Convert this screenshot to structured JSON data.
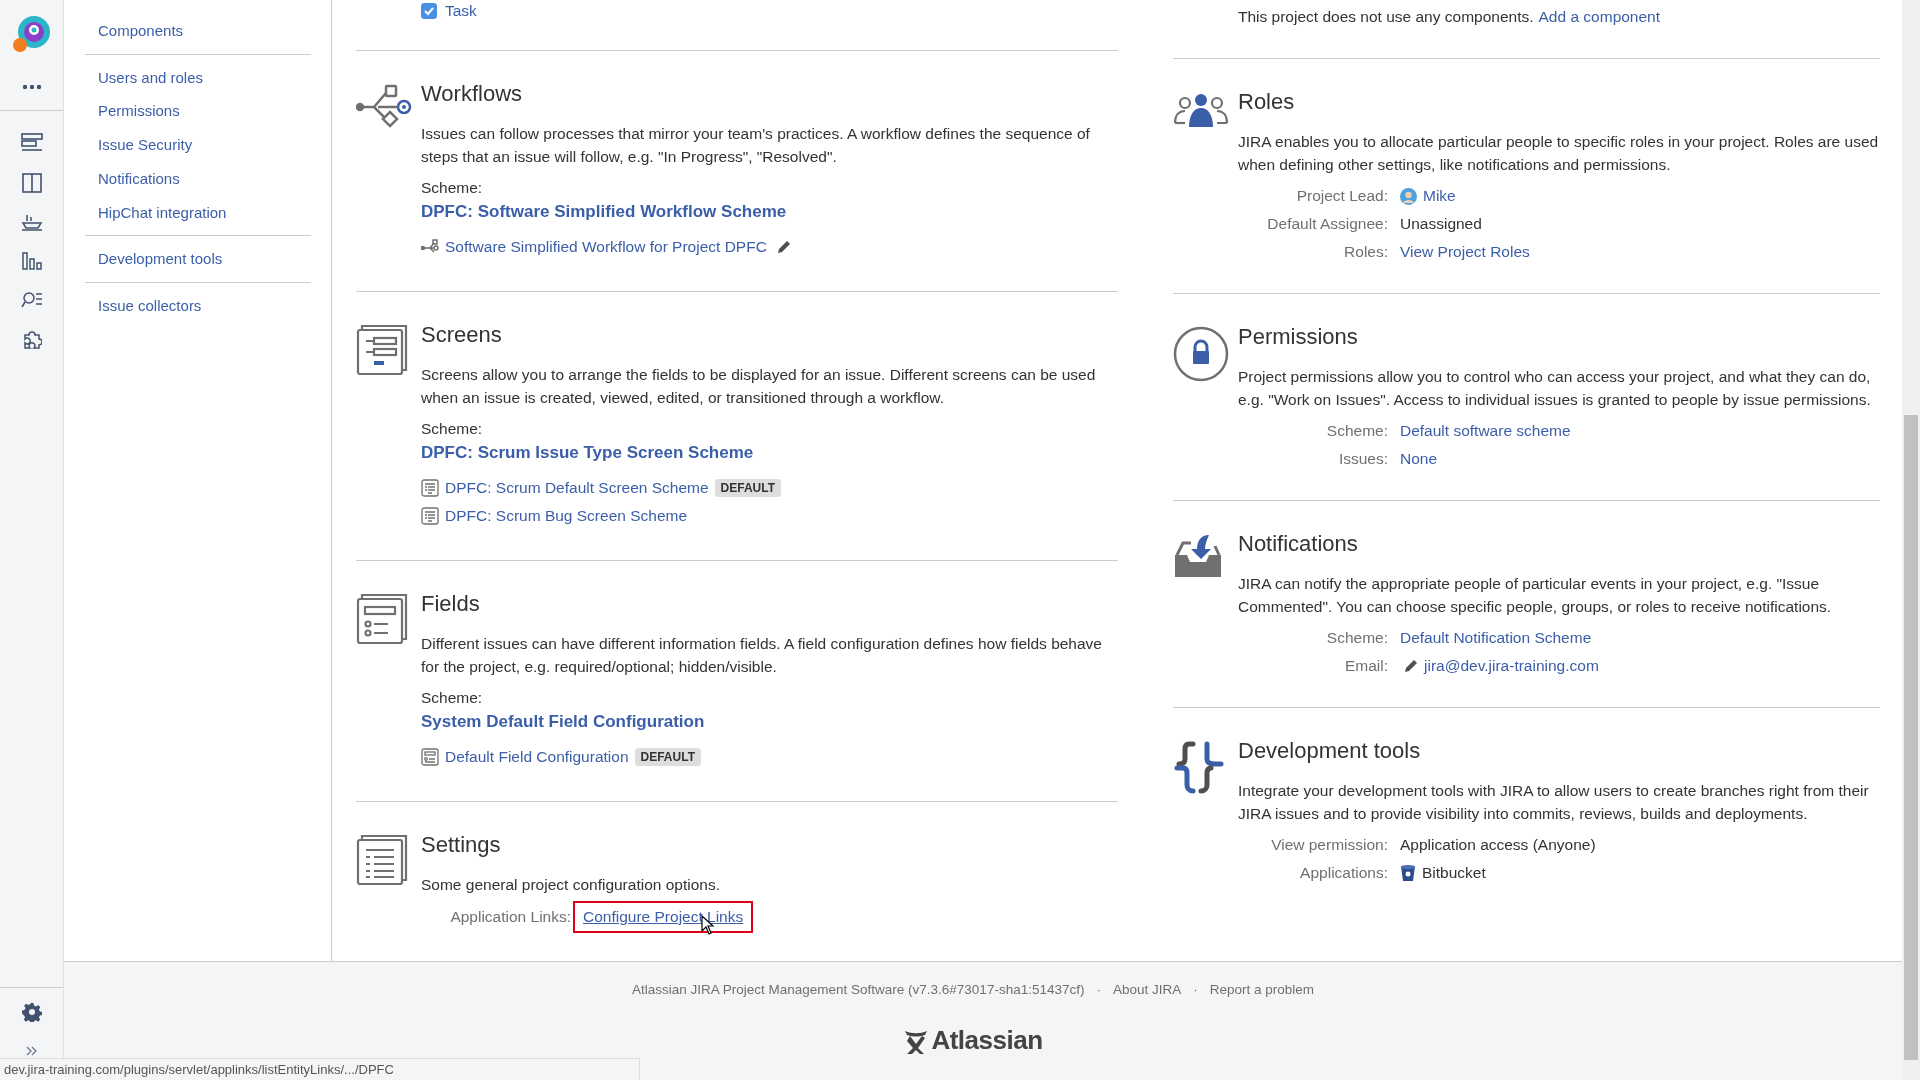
{
  "sidebar": {
    "groups": [
      [
        {
          "label": "Components"
        }
      ],
      [
        {
          "label": "Users and roles"
        },
        {
          "label": "Permissions"
        },
        {
          "label": "Issue Security"
        },
        {
          "label": "Notifications"
        },
        {
          "label": "HipChat integration"
        }
      ],
      [
        {
          "label": "Development tools"
        }
      ],
      [
        {
          "label": "Issue collectors"
        }
      ]
    ]
  },
  "left_column": {
    "top": {
      "label": "Task",
      "checked": true
    },
    "sections": [
      {
        "kind": "workflows",
        "title": "Workflows",
        "description": "Issues can follow processes that mirror your team's practices. A workflow defines the sequence of steps that an issue will follow, e.g. \"In Progress\", \"Resolved\".",
        "scheme_label": "Scheme:",
        "scheme": "DPFC: Software Simplified Workflow Scheme",
        "items": [
          {
            "label": "Software Simplified Workflow for Project DPFC",
            "editable": true
          }
        ]
      },
      {
        "kind": "screens",
        "title": "Screens",
        "description": "Screens allow you to arrange the fields to be displayed for an issue. Different screens can be used when an issue is created, viewed, edited, or transitioned through a workflow.",
        "scheme_label": "Scheme:",
        "scheme": "DPFC: Scrum Issue Type Screen Scheme",
        "items": [
          {
            "label": "DPFC: Scrum Default Screen Scheme",
            "badge": "DEFAULT",
            "editable": false
          },
          {
            "label": "DPFC: Scrum Bug Screen Scheme",
            "editable": false
          }
        ]
      },
      {
        "kind": "fields",
        "title": "Fields",
        "description": "Different issues can have different information fields. A field configuration defines how fields behave for the project, e.g. required/optional; hidden/visible.",
        "scheme_label": "Scheme:",
        "scheme": "System Default Field Configuration",
        "items": [
          {
            "label": "Default Field Configuration",
            "badge": "DEFAULT",
            "editable": false
          }
        ]
      },
      {
        "kind": "settings",
        "title": "Settings",
        "description": "Some general project configuration options.",
        "properties": [
          {
            "label": "Application Links:",
            "value": "Configure Project Links",
            "kind": "link",
            "highlighted": true
          }
        ]
      }
    ]
  },
  "right_column": {
    "top": {
      "text": "This project does not use any components.",
      "link": "Add a component"
    },
    "sections": [
      {
        "kind": "roles",
        "title": "Roles",
        "description": "JIRA enables you to allocate particular people to specific roles in your project. Roles are used when defining other settings, like notifications and permissions.",
        "properties": [
          {
            "label": "Project Lead:",
            "value": "Mike",
            "kind": "person"
          },
          {
            "label": "Default Assignee:",
            "value": "Unassigned",
            "kind": "text"
          },
          {
            "label": "Roles:",
            "value": "View Project Roles",
            "kind": "link"
          }
        ]
      },
      {
        "kind": "permissions",
        "title": "Permissions",
        "description": "Project permissions allow you to control who can access your project, and what they can do, e.g. \"Work on Issues\". Access to individual issues is granted to people by issue permissions.",
        "properties": [
          {
            "label": "Scheme:",
            "value": "Default software scheme",
            "kind": "link"
          },
          {
            "label": "Issues:",
            "value": "None",
            "kind": "link"
          }
        ]
      },
      {
        "kind": "notifications",
        "title": "Notifications",
        "description": "JIRA can notify the appropriate people of particular events in your project, e.g. \"Issue Commented\". You can choose specific people, groups, or roles to receive notifications.",
        "properties": [
          {
            "label": "Scheme:",
            "value": "Default Notification Scheme",
            "kind": "link"
          },
          {
            "label": "Email:",
            "value": "jira@dev.jira-training.com",
            "kind": "email"
          }
        ]
      },
      {
        "kind": "development",
        "title": "Development tools",
        "description": "Integrate your development tools with JIRA to allow users to create branches right from their JIRA issues and to provide visibility into commits, reviews, builds and deployments.",
        "properties": [
          {
            "label": "View permission:",
            "value": "Application access (Anyone)",
            "kind": "text"
          },
          {
            "label": "Applications:",
            "value": "Bitbucket",
            "kind": "app"
          }
        ]
      }
    ]
  },
  "footer": {
    "separator": "·",
    "items": [
      {
        "label": "Atlassian JIRA Project Management Software (v7.3.6#73017-sha1:51437cf)"
      },
      {
        "label": "About JIRA"
      },
      {
        "label": "Report a problem"
      }
    ],
    "logo": "Atlassian"
  },
  "status_bar": {
    "url": "dev.jira-training.com/plugins/servlet/applinks/listEntityLinks/.../DPFC"
  }
}
